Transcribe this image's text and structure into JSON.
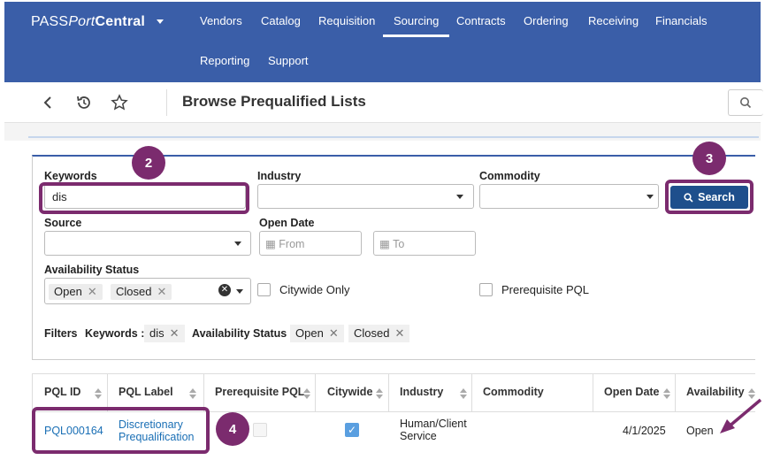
{
  "brand": {
    "pre": "PASS",
    "italic": "Port",
    "bold": "Central"
  },
  "nav": {
    "items": [
      "Vendors",
      "Catalog",
      "Requisition",
      "Sourcing",
      "Contracts",
      "Ordering",
      "Receiving",
      "Financials",
      "Reporting",
      "Support"
    ],
    "active": "Sourcing"
  },
  "header": {
    "title": "Browse Prequalified Lists"
  },
  "filters": {
    "keywords_label": "Keywords",
    "keywords_value": "dis",
    "industry_label": "Industry",
    "commodity_label": "Commodity",
    "source_label": "Source",
    "open_date_label": "Open Date",
    "from_placeholder": "From",
    "to_placeholder": "To",
    "availability_label": "Availability Status",
    "availability_tags": [
      "Open",
      "Closed"
    ],
    "citywide_label": "Citywide Only",
    "prereq_label": "Prerequisite PQL",
    "search_label": "Search"
  },
  "active_filters": {
    "label": "Filters",
    "keywords_label": "Keywords :",
    "keywords_value": "dis",
    "availability_label": "Availability Status :",
    "availability_values": [
      "Open",
      "Closed"
    ]
  },
  "table": {
    "columns": [
      "PQL ID",
      "PQL Label",
      "Prerequisite PQL",
      "Citywide",
      "Industry",
      "Commodity",
      "Open Date",
      "Availability"
    ],
    "rows": [
      {
        "pql_id": "PQL000164",
        "label_line1": "Discretionary",
        "label_line2": "Prequalification",
        "citywide": true,
        "industry_line1": "Human/Client",
        "industry_line2": "Service",
        "open_date": "4/1/2025",
        "availability": "Open"
      }
    ]
  },
  "callouts": [
    "2",
    "3",
    "4"
  ],
  "colors": {
    "nav_bg": "#3a5ea8",
    "callout": "#7b2b6e",
    "search_btn": "#1e4f8c",
    "link": "#1a6fb5"
  }
}
